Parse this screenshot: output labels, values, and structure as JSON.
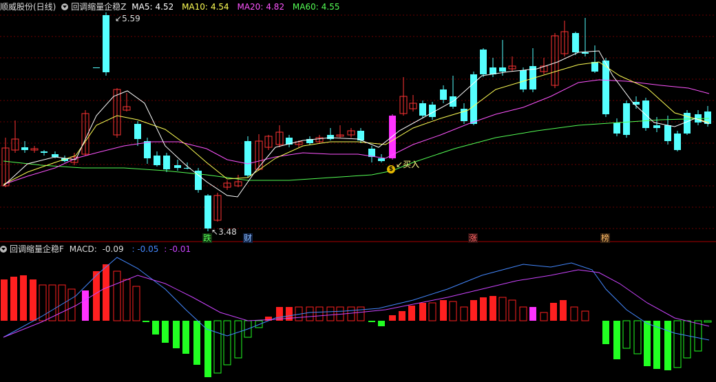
{
  "main_panel": {
    "title": "顺威股份(日线)",
    "indicator_name": "回调缩量企稳Z",
    "ma": [
      {
        "label": "MA5:",
        "value": "4.52",
        "color": "#ffffff"
      },
      {
        "label": "MA10:",
        "value": "4.54",
        "color": "#ffff55"
      },
      {
        "label": "MA20:",
        "value": "4.82",
        "color": "#ff55ff"
      },
      {
        "label": "MA60:",
        "value": "4.55",
        "color": "#55ff55"
      }
    ],
    "high_label": "5.59",
    "low_label": "3.48",
    "buy_label": "买入",
    "buy_icon": "$",
    "events": [
      {
        "text": "跌",
        "color": "#55ff55"
      },
      {
        "text": "财",
        "color": "#55aaff"
      },
      {
        "text": "涨",
        "color": "#ff5555"
      },
      {
        "text": "榜",
        "color": "#ffaa55"
      }
    ]
  },
  "macd_panel": {
    "indicator_name": "回调缩量企稳F",
    "macd_label": "MACD:",
    "macd_value": "-0.09",
    "dif_value": ": -0.05",
    "dea_value": ": -0.01"
  },
  "colors": {
    "up": "#ff3333",
    "down": "#55ffff",
    "macd_pos": "#ff2020",
    "macd_neg": "#22ff22",
    "highlight": "#ff33ff",
    "dif": "#4488ff",
    "dea": "#cc44ff"
  }
}
